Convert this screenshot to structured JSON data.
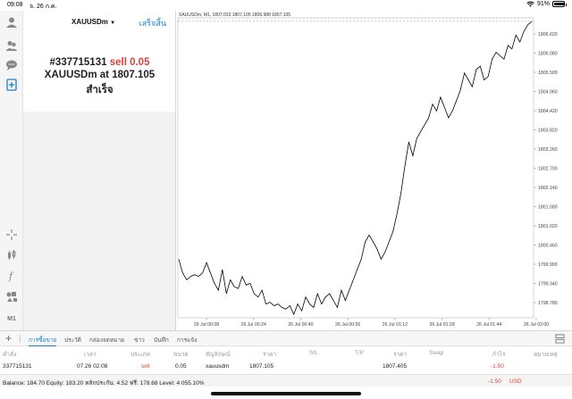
{
  "status_bar": {
    "time": "09:08",
    "date": "จ. 26 ก.ค.",
    "battery": "91%",
    "battery_level": 0.91
  },
  "panel": {
    "symbol": "XAUUSDm",
    "done_label": "เสร็จสิ้น",
    "order_prefix": "#337715131",
    "order_action": "sell 0.05",
    "order_line2_prefix": "XAUUSDm at",
    "order_price": "1807.105",
    "order_status": "สำเร็จ"
  },
  "toolbar": {
    "items": [
      "user-icon",
      "users-icon",
      "chat-icon",
      "new-order-icon",
      "crosshair-icon",
      "indicators-icon",
      "function-icon",
      "objects-icon"
    ],
    "timeframe": "M1"
  },
  "chart": {
    "header": "XAUUSDm, M1, 1807.033 1807.105 1806.988 1807.105"
  },
  "chart_data": {
    "type": "line",
    "x_ticks": [
      "26 Jul 00:08",
      "26 Jul 00:24",
      "26 Jul 00:40",
      "26 Jul 00:56",
      "26 Jul 01:12",
      "26 Jul 01:28",
      "26 Jul 01:44",
      "26 Jul 02:00"
    ],
    "y_ticks": [
      "1806.620",
      "1806.080",
      "1805.500",
      "1804.960",
      "1804.420",
      "1803.820",
      "1803.260",
      "1802.700",
      "1802.140",
      "1801.580",
      "1801.020",
      "1800.460",
      "1799.900",
      "1799.340",
      "1798.780"
    ],
    "ylim": [
      1798.5,
      1807.2
    ],
    "close_values": [
      1800.2,
      1799.8,
      1799.6,
      1799.7,
      1799.75,
      1799.7,
      1799.8,
      1800.1,
      1799.8,
      1799.5,
      1799.3,
      1799.9,
      1799.2,
      1799.6,
      1799.4,
      1799.35,
      1799.7,
      1799.45,
      1799.5,
      1799.2,
      1799.1,
      1799.3,
      1798.9,
      1798.95,
      1798.85,
      1798.9,
      1798.8,
      1798.75,
      1798.85,
      1798.6,
      1798.9,
      1798.7,
      1799.1,
      1798.9,
      1798.8,
      1799.2,
      1798.9,
      1799.1,
      1799.2,
      1799.0,
      1798.8,
      1799.3,
      1799.0,
      1799.3,
      1799.6,
      1799.9,
      1800.2,
      1800.7,
      1800.9,
      1800.7,
      1800.5,
      1800.2,
      1800.4,
      1800.7,
      1801.0,
      1801.5,
      1802.1,
      1802.9,
      1803.6,
      1803.2,
      1803.7,
      1803.9,
      1804.1,
      1804.3,
      1804.7,
      1804.5,
      1804.9,
      1804.6,
      1804.3,
      1804.5,
      1804.8,
      1805.1,
      1805.6,
      1805.4,
      1805.2,
      1805.7,
      1805.8,
      1805.4,
      1805.5,
      1806.0,
      1806.2,
      1806.1,
      1806.0,
      1806.4,
      1806.3,
      1806.7,
      1806.5,
      1806.8,
      1807.0,
      1807.1
    ]
  },
  "tabs": {
    "items": [
      "การซื้อขาย",
      "ประวัติ",
      "กล่องจดหมาย",
      "ข่าว",
      "บันทึก",
      "การแจ้ง"
    ],
    "active": 0
  },
  "trades": {
    "headers": [
      "คำสั่ง",
      "เวลา",
      "ประเภท",
      "ขนาด",
      "สัญลักษณ์",
      "ราคา",
      "S/L",
      "T/P",
      "ราคา",
      "Swap",
      "กำไร",
      "หมายเหตุ"
    ],
    "rows": [
      {
        "order": "337715131",
        "time": "07.26 02:08",
        "type": "sell",
        "size": "0.05",
        "symbol": "xauusdm",
        "price": "1807.105",
        "sl": "",
        "tp": "",
        "current": "1807.405",
        "swap": "",
        "profit": "-1.50",
        "comment": ""
      }
    ],
    "balance_text": "Balance: 184.70 Equity: 183.20 หลักประกัน: 4.52 ฟรี: 178.68 Level: 4 055.10%",
    "total_profit": "-1.50",
    "currency": "USD"
  },
  "colors": {
    "accent": "#1a7fd6",
    "sell": "#e0403a",
    "line": "#000000"
  }
}
